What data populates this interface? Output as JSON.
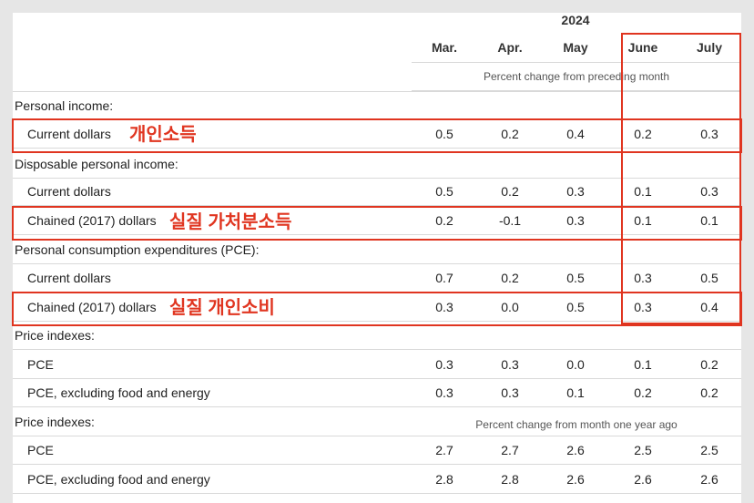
{
  "header": {
    "year": "2024",
    "months": [
      "Mar.",
      "Apr.",
      "May",
      "June",
      "July"
    ],
    "note_monthly": "Percent change from preceding month",
    "note_yearly": "Percent change from month one year ago"
  },
  "rows": [
    {
      "label": "Personal income:",
      "type": "section"
    },
    {
      "label": "Current dollars",
      "type": "data",
      "values": [
        "0.5",
        "0.2",
        "0.4",
        "0.2",
        "0.3"
      ],
      "annotation": "개인소득"
    },
    {
      "label": "Disposable personal income:",
      "type": "section"
    },
    {
      "label": "Current dollars",
      "type": "data",
      "values": [
        "0.5",
        "0.2",
        "0.3",
        "0.1",
        "0.3"
      ]
    },
    {
      "label": "Chained (2017) dollars",
      "type": "data",
      "values": [
        "0.2",
        "-0.1",
        "0.3",
        "0.1",
        "0.1"
      ],
      "annotation": "실질 가처분소득"
    },
    {
      "label": "Personal consumption expenditures (PCE):",
      "type": "section"
    },
    {
      "label": "Current dollars",
      "type": "data",
      "values": [
        "0.7",
        "0.2",
        "0.5",
        "0.3",
        "0.5"
      ]
    },
    {
      "label": "Chained (2017) dollars",
      "type": "data",
      "values": [
        "0.3",
        "0.0",
        "0.5",
        "0.3",
        "0.4"
      ],
      "annotation": "실질 개인소비"
    },
    {
      "label": "Price indexes:",
      "type": "section"
    },
    {
      "label": "PCE",
      "type": "data",
      "values": [
        "0.3",
        "0.3",
        "0.0",
        "0.1",
        "0.2"
      ]
    },
    {
      "label": "PCE, excluding food and energy",
      "type": "data",
      "values": [
        "0.3",
        "0.3",
        "0.1",
        "0.2",
        "0.2"
      ]
    },
    {
      "label": "Price indexes:",
      "type": "section"
    },
    {
      "label": "PCE",
      "type": "data",
      "values": [
        "2.7",
        "2.7",
        "2.6",
        "2.5",
        "2.5"
      ]
    },
    {
      "label": "PCE, excluding food and energy",
      "type": "data",
      "values": [
        "2.8",
        "2.8",
        "2.6",
        "2.6",
        "2.6"
      ]
    }
  ],
  "colors": {
    "highlight": "#e03520"
  }
}
